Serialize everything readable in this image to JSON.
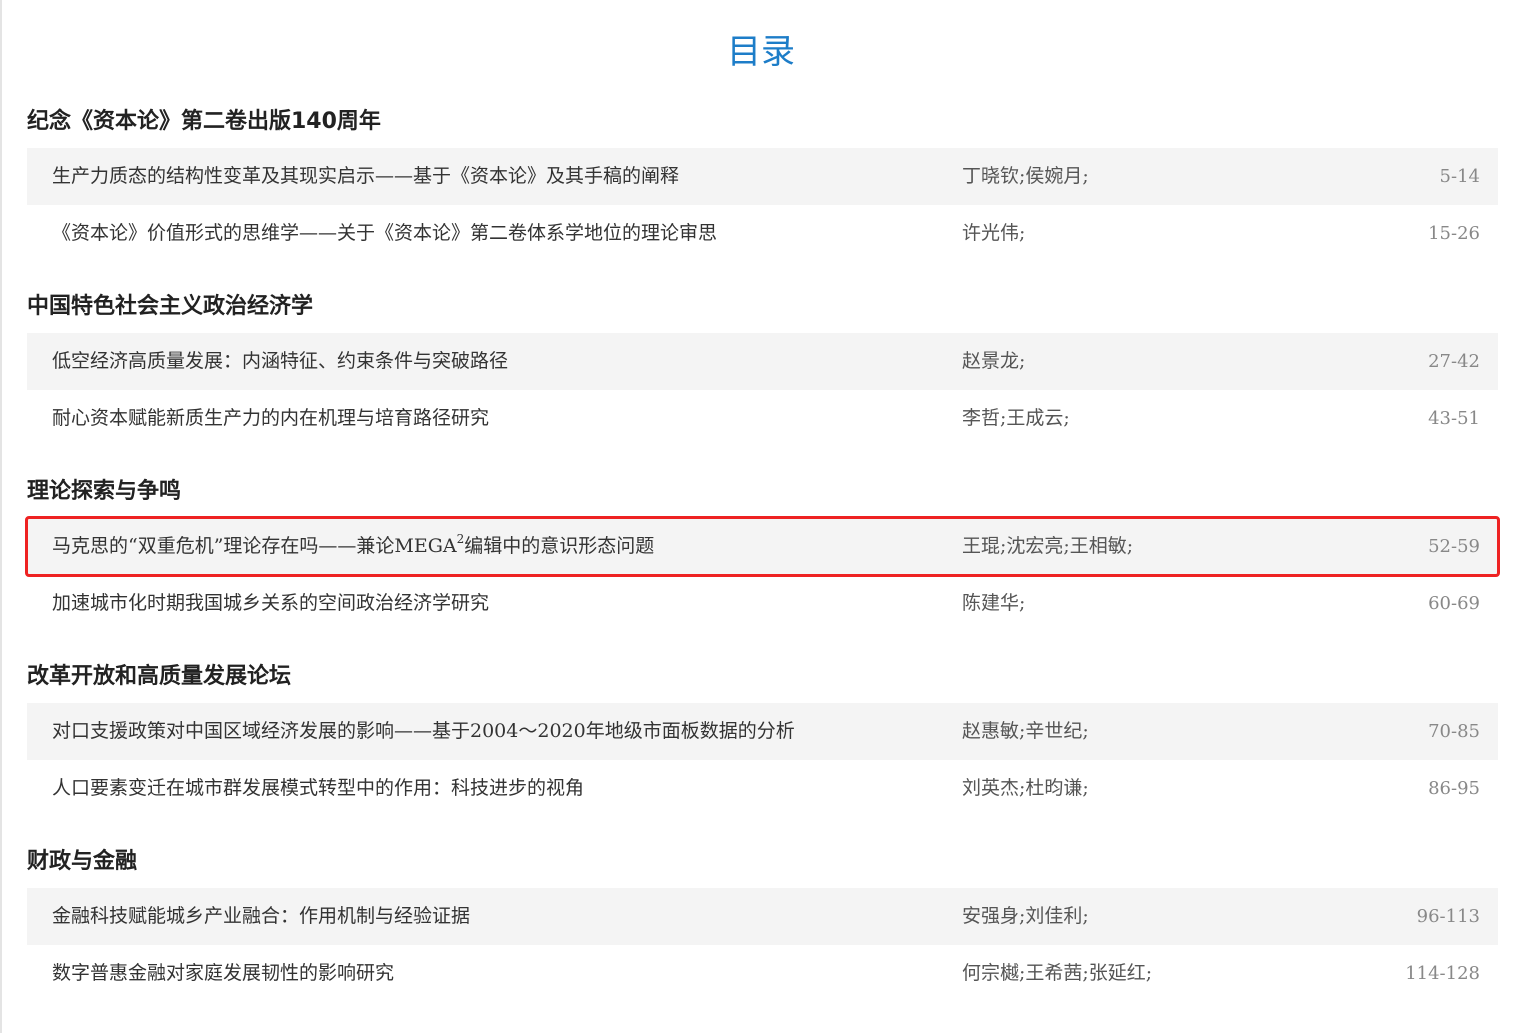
{
  "page": {
    "title": "目录"
  },
  "sections": [
    {
      "title": "纪念《资本论》第二卷出版140周年",
      "articles": [
        {
          "title": "生产力质态的结构性变革及其现实启示——基于《资本论》及其手稿的阐释",
          "authors": "丁晓钦;侯婉月;",
          "pages": "5-14"
        },
        {
          "title": "《资本论》价值形式的思维学——关于《资本论》第二卷体系学地位的理论审思",
          "authors": "许光伟;",
          "pages": "15-26"
        }
      ]
    },
    {
      "title": "中国特色社会主义政治经济学",
      "articles": [
        {
          "title": "低空经济高质量发展：内涵特征、约束条件与突破路径",
          "authors": "赵景龙;",
          "pages": "27-42"
        },
        {
          "title": "耐心资本赋能新质生产力的内在机理与培育路径研究",
          "authors": "李哲;王成云;",
          "pages": "43-51"
        }
      ]
    },
    {
      "title": "理论探索与争鸣",
      "articles": [
        {
          "title_pre": "马克思的“双重危机”理论存在吗——兼论MEGA",
          "title_sup": "2",
          "title_post": "编辑中的意识形态问题",
          "authors": "王琨;沈宏亮;王相敏;",
          "pages": "52-59",
          "highlighted": true
        },
        {
          "title": "加速城市化时期我国城乡关系的空间政治经济学研究",
          "authors": "陈建华;",
          "pages": "60-69"
        }
      ]
    },
    {
      "title": "改革开放和高质量发展论坛",
      "articles": [
        {
          "title": "对口支援政策对中国区域经济发展的影响——基于2004～2020年地级市面板数据的分析",
          "authors": "赵惠敏;辛世纪;",
          "pages": "70-85"
        },
        {
          "title": "人口要素变迁在城市群发展模式转型中的作用：科技进步的视角",
          "authors": "刘英杰;杜昀谦;",
          "pages": "86-95"
        }
      ]
    },
    {
      "title": "财政与金融",
      "articles": [
        {
          "title": "金融科技赋能城乡产业融合：作用机制与经验证据",
          "authors": "安强身;刘佳利;",
          "pages": "96-113"
        },
        {
          "title": "数字普惠金融对家庭发展韧性的影响研究",
          "authors": "何宗樾;王希茜;张延红;",
          "pages": "114-128"
        }
      ]
    }
  ],
  "colors": {
    "title": "#1d7dc8",
    "row_shade": "#f4f4f4",
    "highlight_border": "#ee2222"
  }
}
